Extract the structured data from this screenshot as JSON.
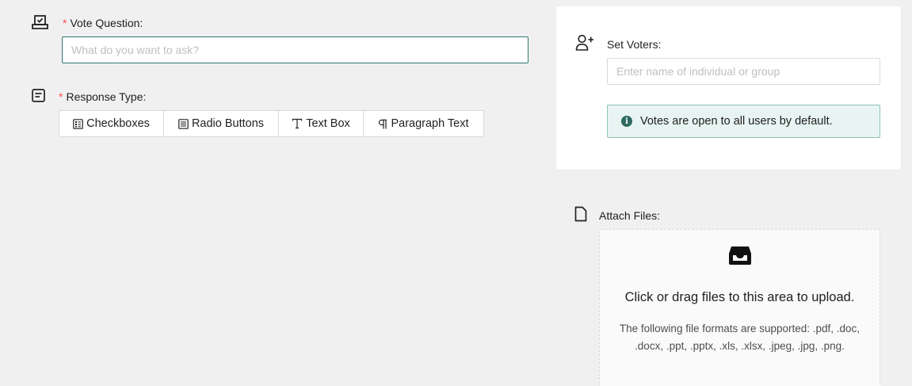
{
  "vote_question": {
    "required_mark": "*",
    "label": "Vote Question",
    "colon": ":",
    "placeholder": "What do you want to ask?",
    "value": ""
  },
  "response_type": {
    "required_mark": "*",
    "label": "Response Type",
    "colon": ":",
    "options": [
      {
        "label": "Checkboxes",
        "icon": "checklist-icon"
      },
      {
        "label": "Radio Buttons",
        "icon": "list-icon"
      },
      {
        "label": "Text Box",
        "icon": "text-icon"
      },
      {
        "label": "Paragraph Text",
        "icon": "pilcrow-icon"
      }
    ]
  },
  "voters": {
    "label": "Set Voters",
    "colon": ":",
    "placeholder": "Enter name of individual or group",
    "value": "",
    "info": "Votes are open to all users by default."
  },
  "attach": {
    "label": "Attach Files",
    "colon": ":",
    "upload_title": "Click or drag files to this area to upload.",
    "upload_hint": "The following file formats are supported: .pdf, .doc, .docx, .ppt, .pptx, .xls, .xlsx, .jpeg, .jpg, .png."
  },
  "colors": {
    "accent": "#2f7a74",
    "required": "#ff4d4f",
    "info_bg": "#e8f4f2",
    "info_border": "#8ec2bb"
  }
}
